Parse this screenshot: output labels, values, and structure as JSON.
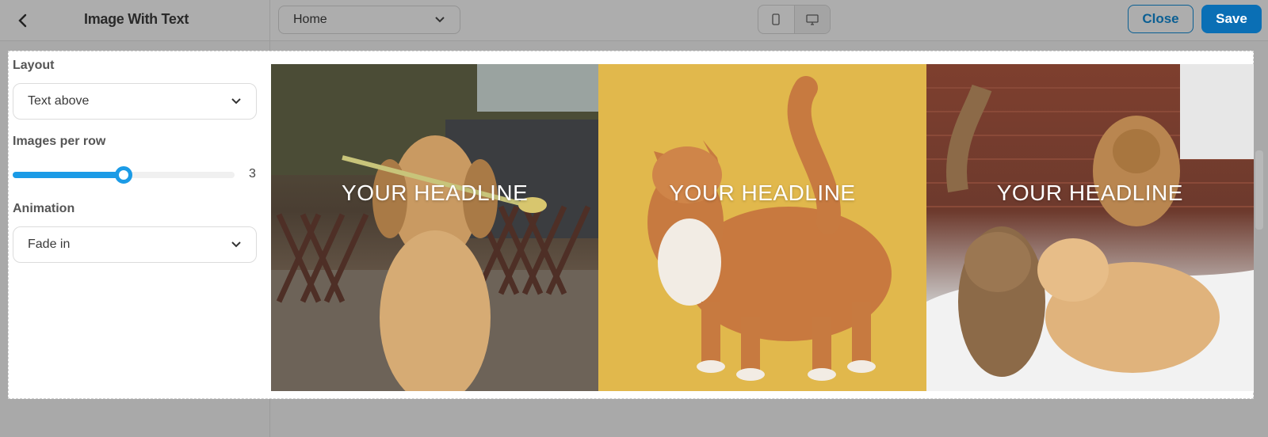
{
  "header": {
    "title": "Image With Text",
    "page_select": "Home",
    "close_label": "Close",
    "save_label": "Save",
    "accent_color": "#0a6fb5"
  },
  "settings": {
    "layout_label": "Layout",
    "layout_value": "Text above",
    "images_per_row_label": "Images per row",
    "images_per_row_value": "3",
    "images_per_row_fraction": 0.5,
    "animation_label": "Animation",
    "animation_value": "Fade in"
  },
  "tiles": [
    {
      "headline": "YOUR HEADLINE",
      "image": "golden-retriever-with-flower"
    },
    {
      "headline": "YOUR HEADLINE",
      "image": "orange-cat-on-yellow"
    },
    {
      "headline": "YOUR HEADLINE",
      "image": "cat-and-pomeranians-in-snow"
    }
  ]
}
